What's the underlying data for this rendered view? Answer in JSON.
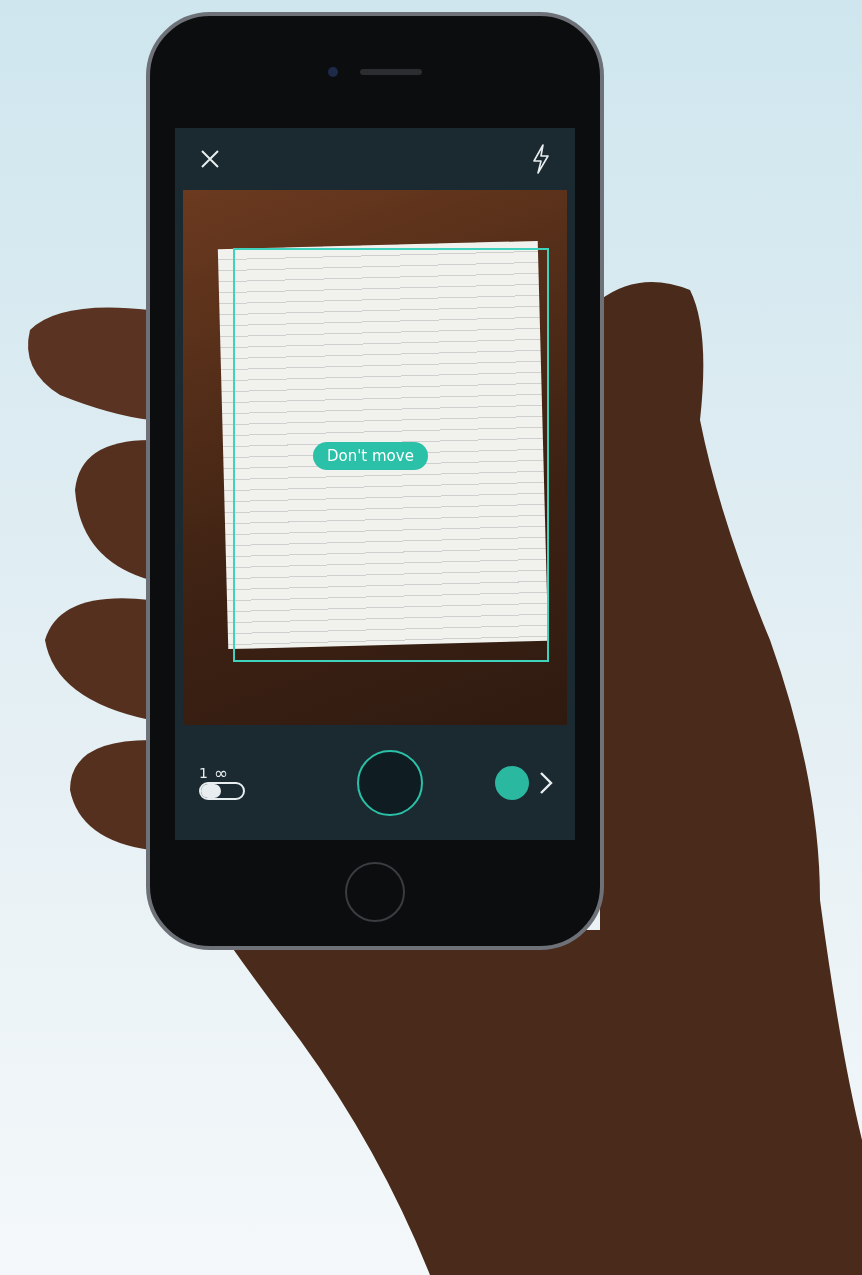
{
  "camera": {
    "hint": "Don't move",
    "multi_toggle": {
      "single_label": "1",
      "multi_label": "∞",
      "on": false
    }
  }
}
